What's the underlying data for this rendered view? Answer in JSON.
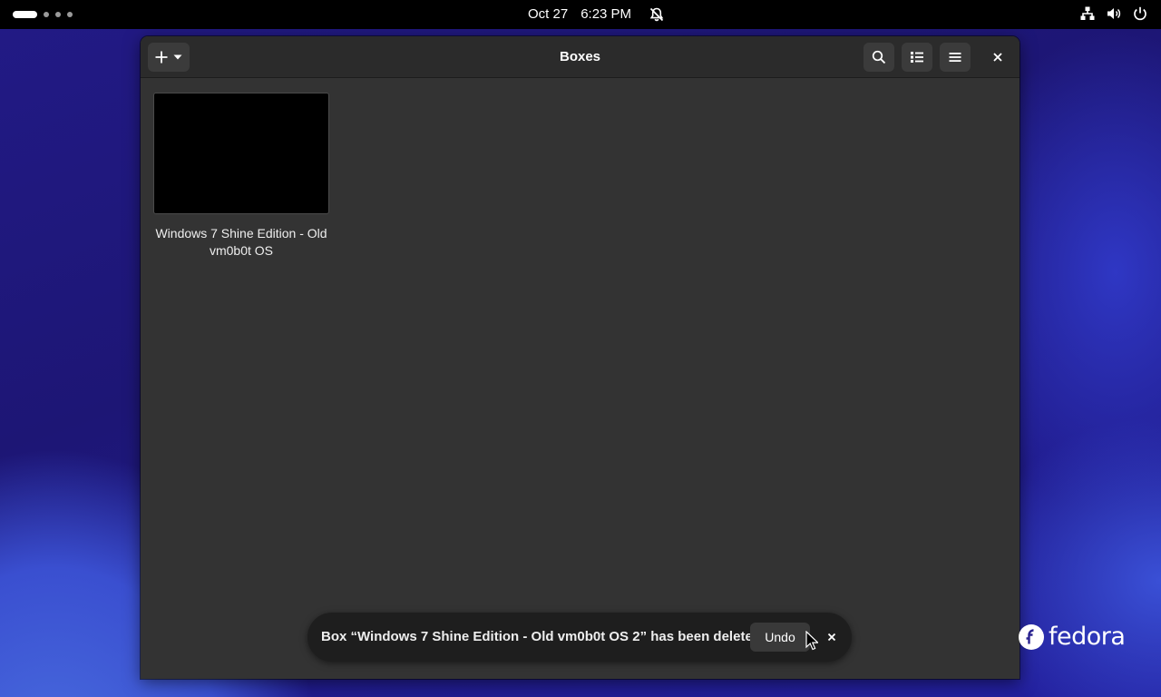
{
  "topbar": {
    "date": "Oct 27",
    "time": "6:23 PM"
  },
  "window": {
    "title": "Boxes"
  },
  "boxes": [
    {
      "name": "Windows 7 Shine Edition - Old vm0b0t OS"
    }
  ],
  "toast": {
    "message": "Box “Windows 7 Shine Edition - Old vm0b0t OS 2” has been deleted",
    "undo_label": "Undo"
  },
  "branding": {
    "wordmark": "fedora"
  },
  "icons": {
    "topbar": [
      "workspace-indicator-icon",
      "notifications-muted-icon",
      "network-wired-icon",
      "volume-icon",
      "power-icon"
    ],
    "headerbar": [
      "add-icon",
      "chevron-down-icon",
      "search-icon",
      "list-view-icon",
      "hamburger-menu-icon",
      "close-icon"
    ]
  },
  "colors": {
    "topbar_bg": "#000000",
    "window_bg": "#333333",
    "headerbar_bg": "#2b2b2b",
    "toast_bg": "#1e1e1e",
    "thumbnail_bg": "#000000"
  }
}
